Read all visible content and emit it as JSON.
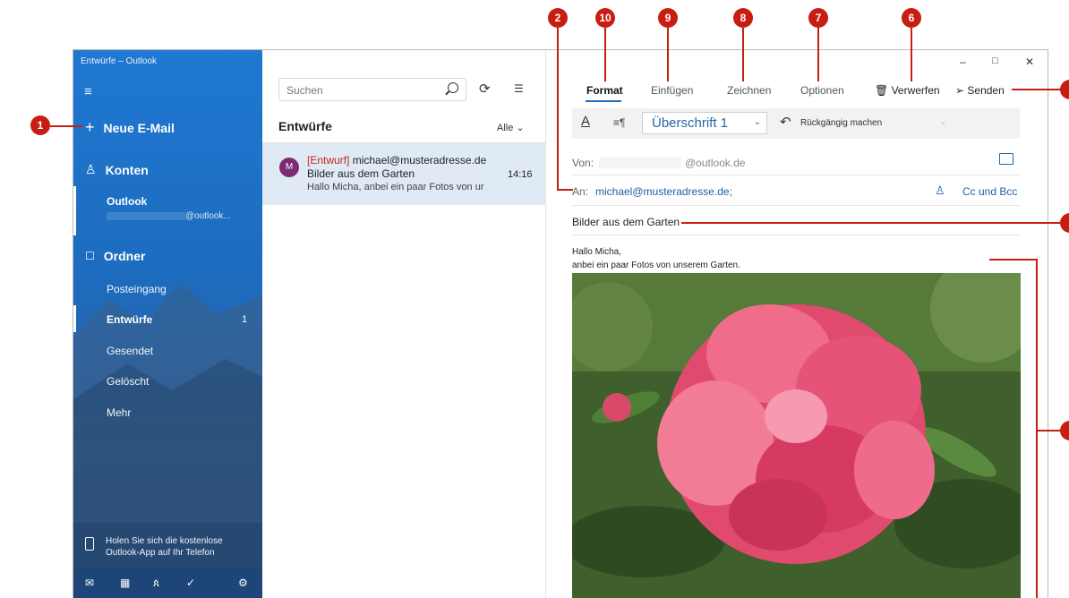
{
  "window": {
    "title": "Entwürfe – Outlook",
    "controls": {
      "minimize": "–",
      "maximize": "□",
      "close": "✕"
    }
  },
  "sidebar": {
    "new_mail": "Neue E-Mail",
    "accounts_header": "Konten",
    "account": {
      "name": "Outlook",
      "email_suffix": "@outlook..."
    },
    "folders_header": "Ordner",
    "folders": [
      {
        "label": "Posteingang"
      },
      {
        "label": "Entwürfe",
        "count": "1",
        "selected": true
      },
      {
        "label": "Gesendet"
      },
      {
        "label": "Gelöscht"
      },
      {
        "label": "Mehr"
      }
    ],
    "promo": "Holen Sie sich die kostenlose Outlook-App auf Ihr Telefon",
    "bottom_icons": [
      "mail-icon",
      "calendar-icon",
      "people-icon",
      "todo-icon",
      "settings-icon"
    ]
  },
  "message_list": {
    "search_placeholder": "Suchen",
    "folder_title": "Entwürfe",
    "filter": "Alle",
    "item": {
      "avatar": "M",
      "draft_tag": "[Entwurf]",
      "from": "michael@musteradresse.de",
      "subject": "Bilder aus dem Garten",
      "time": "14:16",
      "preview": "Hallo Micha, anbei ein paar Fotos von ur"
    }
  },
  "compose": {
    "tabs": [
      "Format",
      "Einfügen",
      "Zeichnen",
      "Optionen"
    ],
    "active_tab": "Format",
    "discard": "Verwerfen",
    "send": "Senden",
    "style_select": "Überschrift 1",
    "undo": "Rückgängig machen",
    "from_label": "Von:",
    "from_domain": "@outlook.de",
    "to_label": "An:",
    "to_value": "michael@musteradresse.de;",
    "cc_bcc": "Cc und Bcc",
    "subject": "Bilder aus dem Garten",
    "body_line1": "Hallo Micha,",
    "body_line2": "anbei ein paar Fotos von unserem Garten."
  },
  "callouts": [
    "1",
    "2",
    "10",
    "9",
    "8",
    "7",
    "6"
  ],
  "colors": {
    "accent": "#1b6ec2",
    "callout": "#c81e12",
    "draft_tag": "#c4261d",
    "selected_item": "#dfeaf5"
  }
}
